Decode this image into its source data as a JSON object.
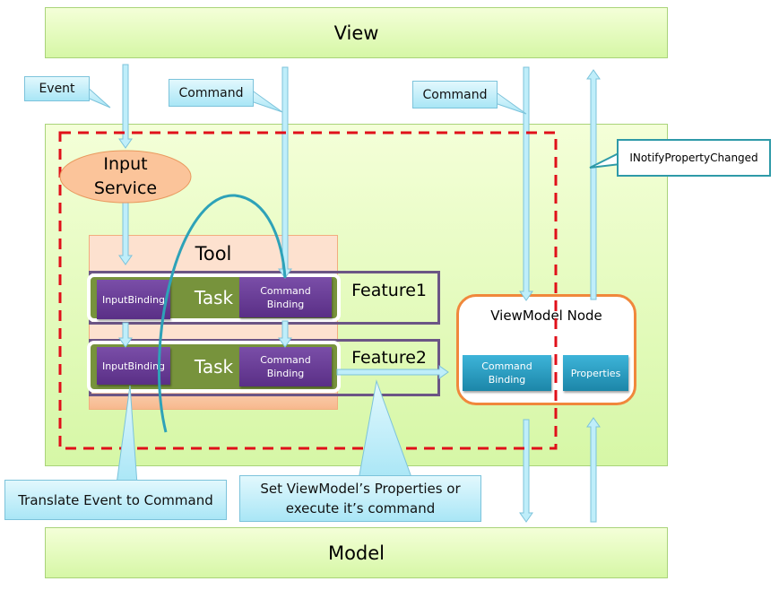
{
  "view": {
    "label": "View"
  },
  "model": {
    "label": "Model"
  },
  "callouts": {
    "event": "Event",
    "command1": "Command",
    "command2": "Command",
    "notify": "INotifyPropertyChanged",
    "translate": "Translate Event to Command",
    "set_line1": "Set ViewModel’s Properties or",
    "set_line2": "execute it’s command"
  },
  "input_service": {
    "line1": "Input",
    "line2": "Service"
  },
  "tool": {
    "label": "Tool"
  },
  "features": [
    {
      "label": "Feature1",
      "task": "Task",
      "input_binding": "InputBinding",
      "command_binding_1": "Command",
      "command_binding_2": "Binding"
    },
    {
      "label": "Feature2",
      "task": "Task",
      "input_binding": "InputBinding",
      "command_binding_1": "Command",
      "command_binding_2": "Binding"
    }
  ],
  "viewmodel_node": {
    "label": "ViewModel Node",
    "command_binding_1": "Command",
    "command_binding_2": "Binding",
    "properties": "Properties"
  },
  "colors": {
    "box_green": "#d6f7a6",
    "callout_blue": "#a9e6f6",
    "boundary_red": "#e0101a",
    "task_green": "#77933c",
    "binding_purple": "#5a2f86",
    "node_blue": "#1c86a8",
    "node_border": "#f0883c"
  }
}
